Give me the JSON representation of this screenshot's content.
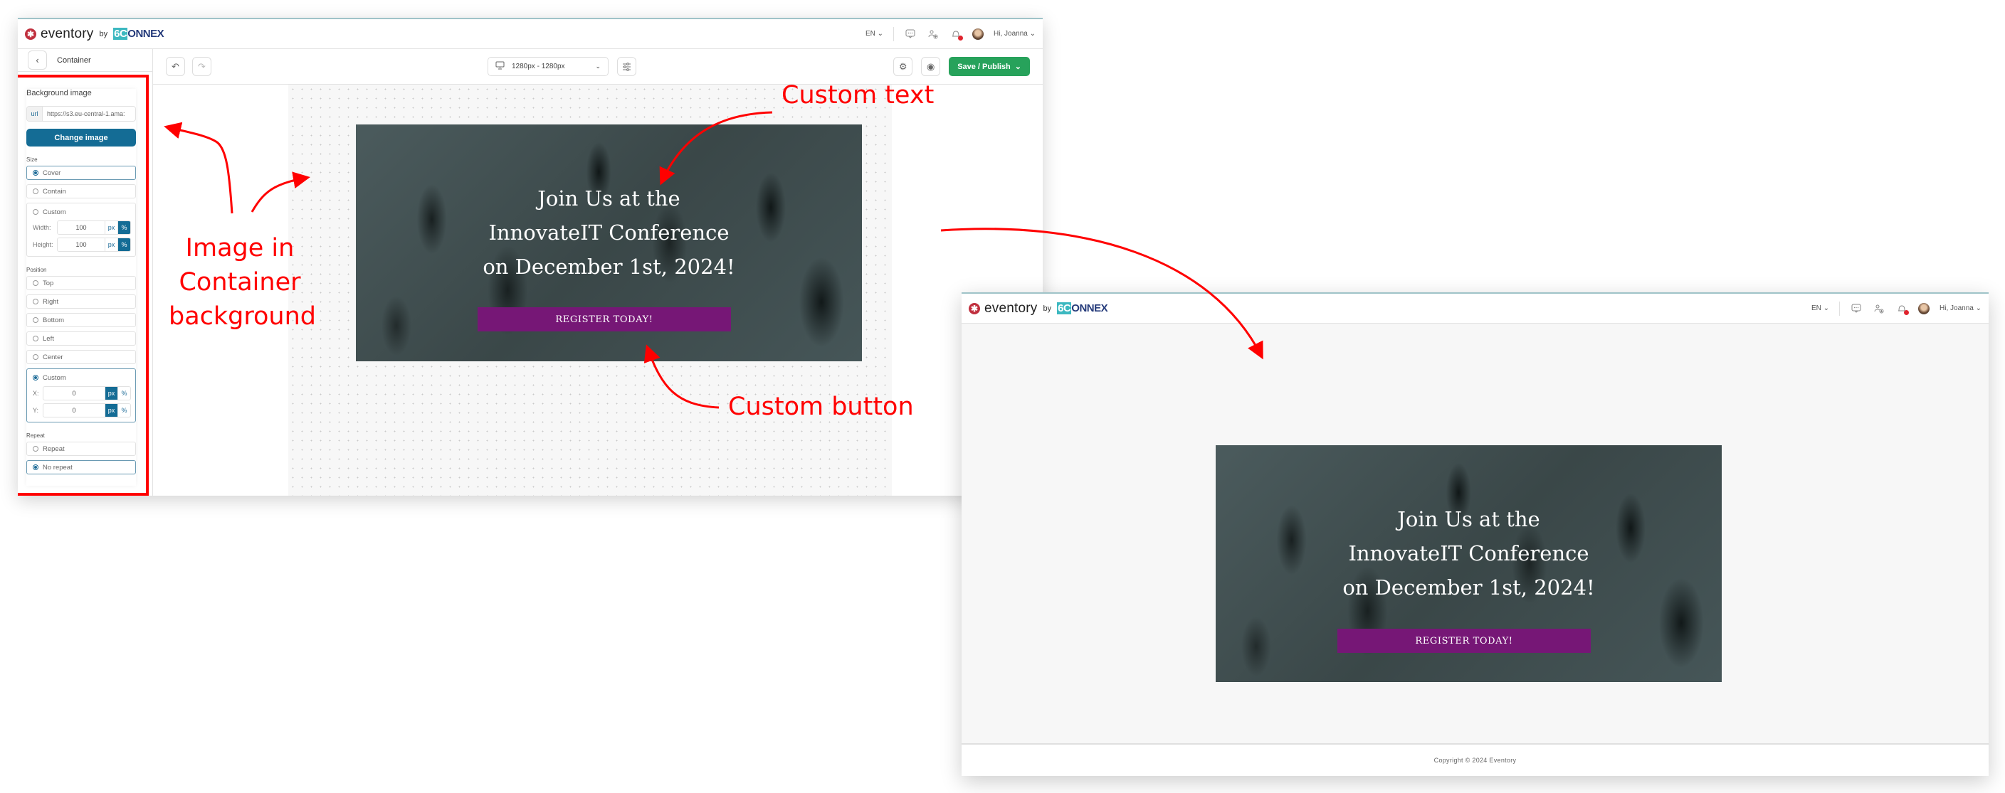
{
  "brand": {
    "logo_mark": "✱",
    "product": "eventory",
    "by": "by",
    "partner_prefix": "6C",
    "partner_suffix": "ONNEX"
  },
  "topbar": {
    "language": "EN ⌄",
    "icons": [
      "chat-icon",
      "add-user-icon",
      "bell-icon"
    ],
    "greeting": "Hi, Joanna ⌄"
  },
  "editor": {
    "back_label": "‹",
    "panel_title": "Container",
    "toolbar": {
      "undo": "↶",
      "redo": "↷",
      "viewport_label": "1280px - 1280px",
      "viewport_chevron": "⌄",
      "settings": "⚙",
      "preview": "◉",
      "publish_label": "Save / Publish",
      "publish_chevron": "⌄"
    },
    "background_panel": {
      "title": "Background image",
      "url_tag": "url",
      "url_value": "https://s3.eu-central-1.ama:",
      "change_button": "Change image",
      "size": {
        "label": "Size",
        "options": [
          {
            "label": "Cover",
            "selected": true
          },
          {
            "label": "Contain",
            "selected": false
          },
          {
            "label": "Custom",
            "selected": false
          }
        ],
        "width_label": "Width:",
        "width_value": "100",
        "height_label": "Height:",
        "height_value": "100",
        "unit_px": "px",
        "unit_pct": "%",
        "active_unit": "%"
      },
      "position": {
        "label": "Position",
        "options": [
          {
            "label": "Top",
            "selected": false
          },
          {
            "label": "Right",
            "selected": false
          },
          {
            "label": "Bottom",
            "selected": false
          },
          {
            "label": "Left",
            "selected": false
          },
          {
            "label": "Center",
            "selected": false
          },
          {
            "label": "Custom",
            "selected": true
          }
        ],
        "x_label": "X:",
        "x_value": "0",
        "y_label": "Y:",
        "y_value": "0",
        "unit_px": "px",
        "unit_pct": "%",
        "active_unit": "px"
      },
      "repeat": {
        "label": "Repeat",
        "options": [
          {
            "label": "Repeat",
            "selected": false
          },
          {
            "label": "No repeat",
            "selected": true
          }
        ]
      }
    }
  },
  "banner": {
    "line1": "Join Us at the",
    "line2": "InnovateIT Conference",
    "line3": "on December 1st, 2024!",
    "button": "REGISTER TODAY!"
  },
  "preview": {
    "footer": "Copyright © 2024 Eventory"
  },
  "annotations": {
    "custom_text": "Custom text",
    "custom_button": "Custom button",
    "image_bg_line1": "Image in",
    "image_bg_line2": "Container",
    "image_bg_line3": "background"
  },
  "colors": {
    "accent_blue": "#146c95",
    "publish_green": "#27a25b",
    "banner_button": "#761776",
    "annotation_red": "#ff0000",
    "notification_dot": "#e0242e"
  }
}
